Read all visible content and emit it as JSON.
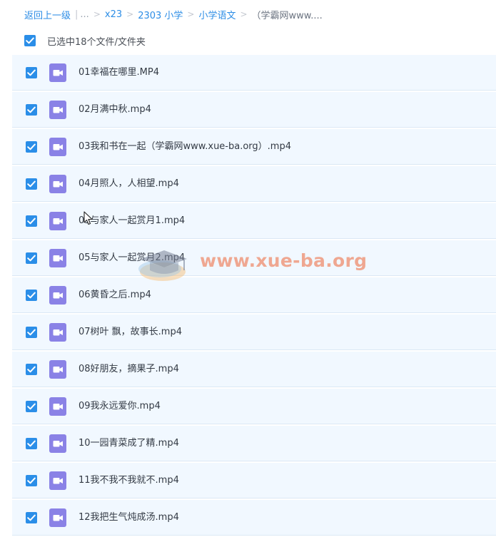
{
  "breadcrumb": {
    "back_label": "返回上一级",
    "ellipsis": "...",
    "separator": ">",
    "items": [
      "x23",
      "2303 小学",
      "小学语文"
    ],
    "current": "（学霸网www...."
  },
  "selection": {
    "label": "已选中18个文件/文件夹",
    "checked": true
  },
  "files": [
    {
      "name": "01幸福在哪里.MP4",
      "icon": "video-file-icon",
      "checked": true
    },
    {
      "name": "02月满中秋.mp4",
      "icon": "video-file-icon",
      "checked": true
    },
    {
      "name": "03我和书在一起（学霸网www.xue-ba.org）.mp4",
      "icon": "video-file-icon",
      "checked": true
    },
    {
      "name": "04月照人，人相望.mp4",
      "icon": "video-file-icon",
      "checked": true
    },
    {
      "name": "05与家人一起赏月1.mp4",
      "icon": "video-file-icon",
      "checked": true
    },
    {
      "name": "05与家人一起赏月2.mp4",
      "icon": "video-file-icon",
      "checked": true
    },
    {
      "name": "06黄昏之后.mp4",
      "icon": "video-file-icon",
      "checked": true
    },
    {
      "name": "07树叶 飘，故事长.mp4",
      "icon": "video-file-icon",
      "checked": true
    },
    {
      "name": "08好朋友，摘果子.mp4",
      "icon": "video-file-icon",
      "checked": true
    },
    {
      "name": "09我永远爱你.mp4",
      "icon": "video-file-icon",
      "checked": true
    },
    {
      "name": "10一园青菜成了精.mp4",
      "icon": "video-file-icon",
      "checked": true
    },
    {
      "name": "11我不我不我就不.mp4",
      "icon": "video-file-icon",
      "checked": true
    },
    {
      "name": "12我把生气炖成汤.mp4",
      "icon": "video-file-icon",
      "checked": true
    }
  ],
  "watermark": {
    "text": "www.xue-ba.org",
    "color": "#ee764e"
  },
  "colors": {
    "accent": "#2b8ee8",
    "row_background": "#f1f8ff",
    "video_icon": "#8a82e6"
  }
}
